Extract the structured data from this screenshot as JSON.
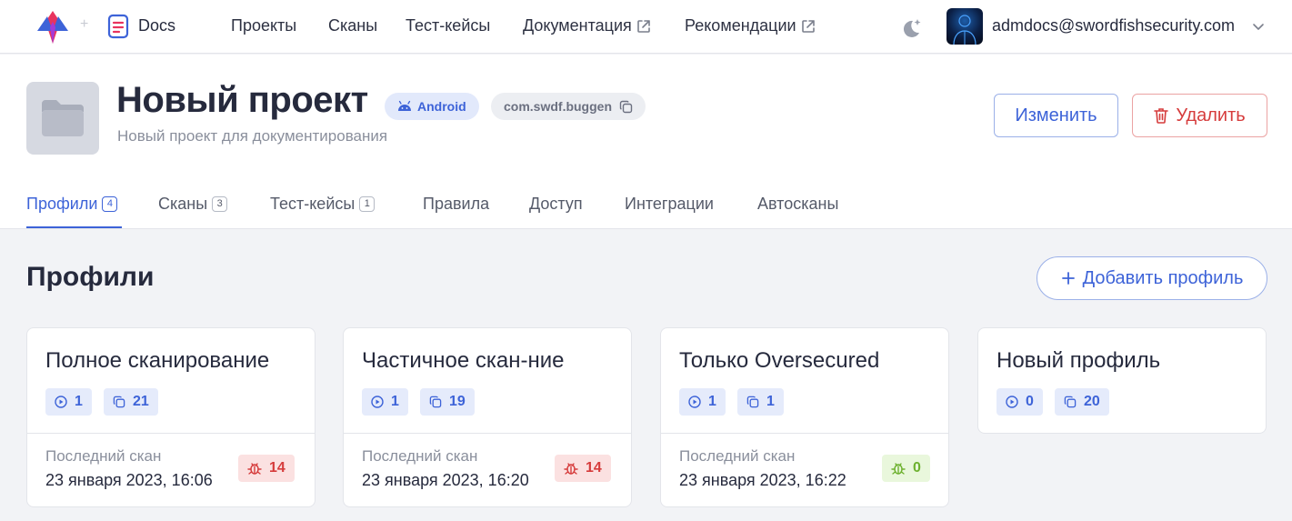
{
  "nav": {
    "brand": "Docs",
    "items": [
      {
        "label": "Проекты",
        "external": false
      },
      {
        "label": "Сканы",
        "external": false
      },
      {
        "label": "Тест-кейсы",
        "external": false
      },
      {
        "label": "Документация",
        "external": true
      },
      {
        "label": "Рекомендации",
        "external": true
      }
    ],
    "user_email": "admdocs@swordfishsecurity.com"
  },
  "project": {
    "title": "Новый проект",
    "platform": "Android",
    "package": "com.swdf.buggen",
    "description": "Новый проект для документирования",
    "edit_label": "Изменить",
    "delete_label": "Удалить"
  },
  "tabs": [
    {
      "label": "Профили",
      "count": "4",
      "active": true
    },
    {
      "label": "Сканы",
      "count": "3",
      "active": false
    },
    {
      "label": "Тест-кейсы",
      "count": "1",
      "active": false
    },
    {
      "label": "Правила",
      "count": null,
      "active": false
    },
    {
      "label": "Доступ",
      "count": null,
      "active": false
    },
    {
      "label": "Интеграции",
      "count": null,
      "active": false
    },
    {
      "label": "Автосканы",
      "count": null,
      "active": false
    }
  ],
  "profiles": {
    "title": "Профили",
    "add_label": "Добавить профиль",
    "last_scan_label": "Последний скан",
    "cards": [
      {
        "title": "Полное сканирование",
        "runs": "1",
        "rules": "21",
        "last_scan": "23 января 2023, 16:06",
        "issues": "14",
        "issue_status": "red"
      },
      {
        "title": "Частичное скан-ние",
        "runs": "1",
        "rules": "19",
        "last_scan": "23 января 2023, 16:20",
        "issues": "14",
        "issue_status": "red"
      },
      {
        "title": "Только Oversecured",
        "runs": "1",
        "rules": "1",
        "last_scan": "23 января 2023, 16:22",
        "issues": "0",
        "issue_status": "green"
      },
      {
        "title": "Новый профиль",
        "runs": "0",
        "rules": "20",
        "last_scan": null,
        "issues": null,
        "issue_status": null
      }
    ]
  },
  "colors": {
    "accent": "#3d63d8",
    "danger": "#d63c3c",
    "success": "#6db12f",
    "background": "#f2f3f6"
  },
  "icons": {
    "logo": "swordfish-logo",
    "docs": "document-icon",
    "external": "external-link-icon",
    "theme": "moon-stars-icon",
    "dropdown": "chevron-down-icon",
    "platform": "android-icon",
    "copy": "copy-icon",
    "trash": "trash-icon",
    "plus": "plus-icon",
    "runs": "play-circle-icon",
    "rules": "copy-icon",
    "issues": "bug-icon"
  }
}
